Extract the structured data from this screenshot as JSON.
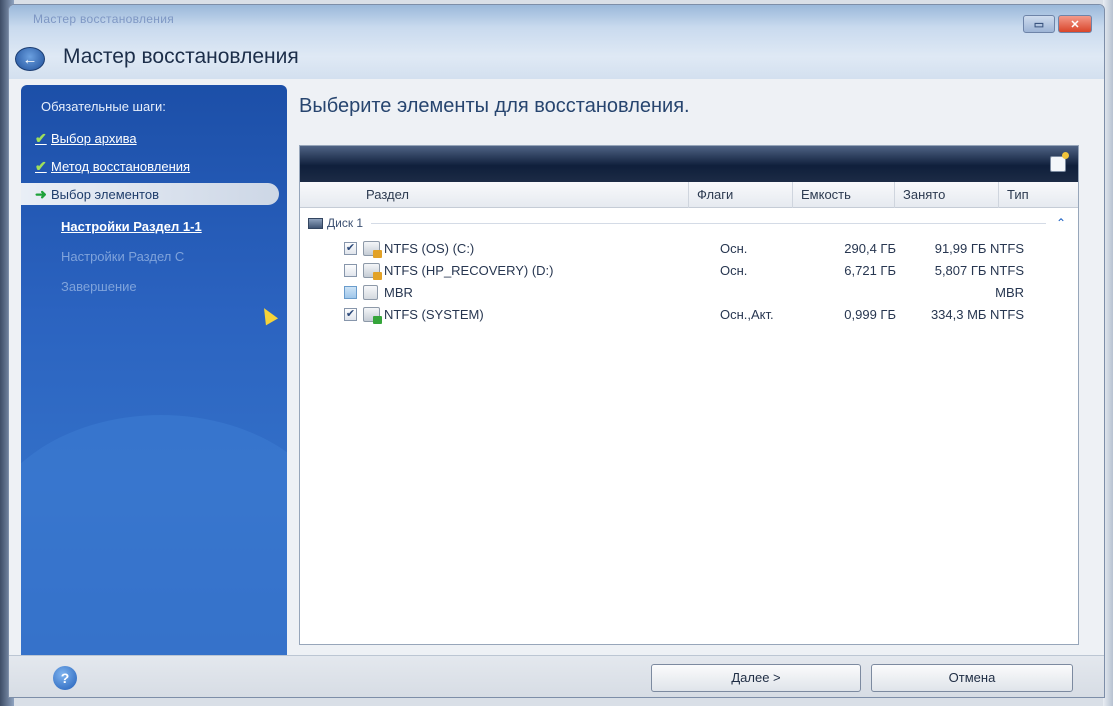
{
  "window": {
    "title_small": "Мастер восстановления",
    "title_main": "Мастер восстановления",
    "restore_glyph": "▭",
    "close_glyph": "✕"
  },
  "sidebar": {
    "header": "Обязательные шаги:",
    "done_check": "✔",
    "current_arrow": "➜",
    "steps": [
      {
        "label": "Выбор архива",
        "state": "done"
      },
      {
        "label": "Метод восстановления",
        "state": "done"
      },
      {
        "label": "Выбор элементов",
        "state": "current"
      },
      {
        "label": "Настройки Раздел 1-1",
        "state": "next"
      },
      {
        "label": "Настройки Раздел С",
        "state": "disabled"
      },
      {
        "label": "Завершение",
        "state": "disabled"
      }
    ]
  },
  "content": {
    "heading": "Выберите элементы для восстановления."
  },
  "table": {
    "columns": {
      "partition": "Раздел",
      "flags": "Флаги",
      "capacity": "Емкость",
      "used": "Занято",
      "type": "Тип"
    },
    "disk_label": "Диск 1",
    "collapse_glyph": "⌃",
    "rows": [
      {
        "name": "NTFS (OS) (C:)",
        "flags": "Осн.",
        "capacity": "290,4 ГБ",
        "used": "91,99 ГБ NTFS",
        "checked": "✔"
      },
      {
        "name": "NTFS (HP_RECOVERY) (D:)",
        "flags": "Осн.",
        "capacity": "6,721 ГБ",
        "used": "5,807 ГБ NTFS",
        "checked": ""
      },
      {
        "name": "MBR",
        "flags": "",
        "capacity": "",
        "used": "MBR",
        "checked": ""
      },
      {
        "name": "NTFS (SYSTEM)",
        "flags": "Осн.,Акт.",
        "capacity": "0,999 ГБ",
        "used": "334,3 МБ NTFS",
        "checked": "✔"
      }
    ]
  },
  "footer": {
    "help_glyph": "?",
    "next_label": "Далее >",
    "cancel_label": "Отмена"
  }
}
